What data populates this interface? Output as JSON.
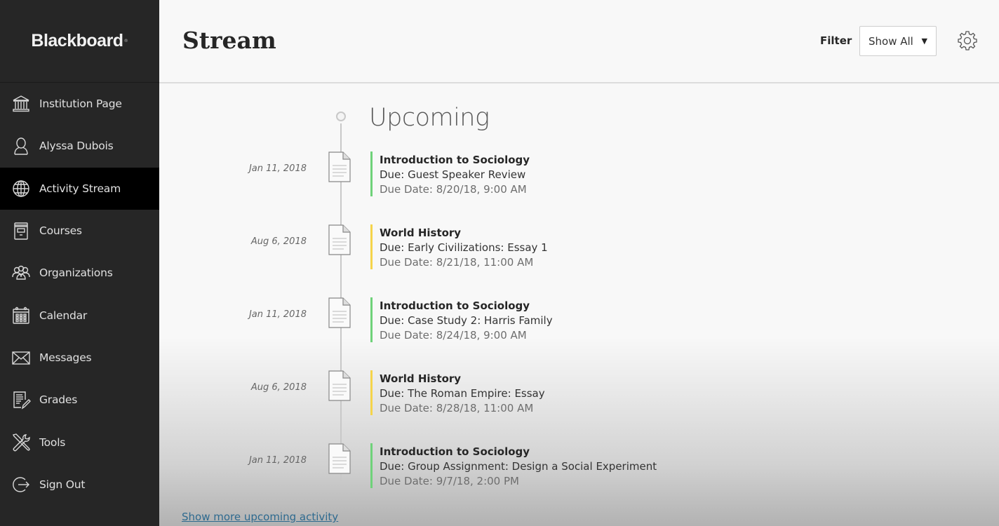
{
  "brand": {
    "name": "Blackboard",
    "mark": "."
  },
  "sidebar": {
    "items": [
      {
        "label": "Institution Page",
        "icon": "institution-icon",
        "active": false
      },
      {
        "label": "Alyssa Dubois",
        "icon": "user-icon",
        "active": false
      },
      {
        "label": "Activity Stream",
        "icon": "globe-icon",
        "active": true
      },
      {
        "label": "Courses",
        "icon": "courses-icon",
        "active": false
      },
      {
        "label": "Organizations",
        "icon": "organizations-icon",
        "active": false
      },
      {
        "label": "Calendar",
        "icon": "calendar-icon",
        "active": false
      },
      {
        "label": "Messages",
        "icon": "envelope-icon",
        "active": false
      },
      {
        "label": "Grades",
        "icon": "grades-icon",
        "active": false
      },
      {
        "label": "Tools",
        "icon": "tools-icon",
        "active": false
      },
      {
        "label": "Sign Out",
        "icon": "sign-out-icon",
        "active": false
      }
    ]
  },
  "header": {
    "title": "Stream",
    "filter_label": "Filter",
    "filter_value": "Show All",
    "settings_icon": "gear-icon"
  },
  "stream": {
    "section_title": "Upcoming",
    "items": [
      {
        "date": "Jan 11, 2018",
        "course": "Introduction to Sociology",
        "due": "Due: Guest Speaker Review",
        "due_date": "Due Date: 8/20/18, 9:00 AM",
        "color": "#6fd27a"
      },
      {
        "date": "Aug 6, 2018",
        "course": "World History",
        "due": "Due: Early Civilizations: Essay 1",
        "due_date": "Due Date: 8/21/18, 11:00 AM",
        "color": "#f5d44a"
      },
      {
        "date": "Jan 11, 2018",
        "course": "Introduction to Sociology",
        "due": "Due: Case Study 2: Harris Family",
        "due_date": "Due Date: 8/24/18, 9:00 AM",
        "color": "#6fd27a"
      },
      {
        "date": "Aug 6, 2018",
        "course": "World History",
        "due": "Due: The Roman Empire: Essay",
        "due_date": "Due Date: 8/28/18, 11:00 AM",
        "color": "#f5d44a"
      },
      {
        "date": "Jan 11, 2018",
        "course": "Introduction to Sociology",
        "due": "Due: Group Assignment: Design a Social Experiment",
        "due_date": "Due Date: 9/7/18, 2:00 PM",
        "color": "#6fd27a"
      }
    ],
    "more_link": "Show more upcoming activity"
  }
}
